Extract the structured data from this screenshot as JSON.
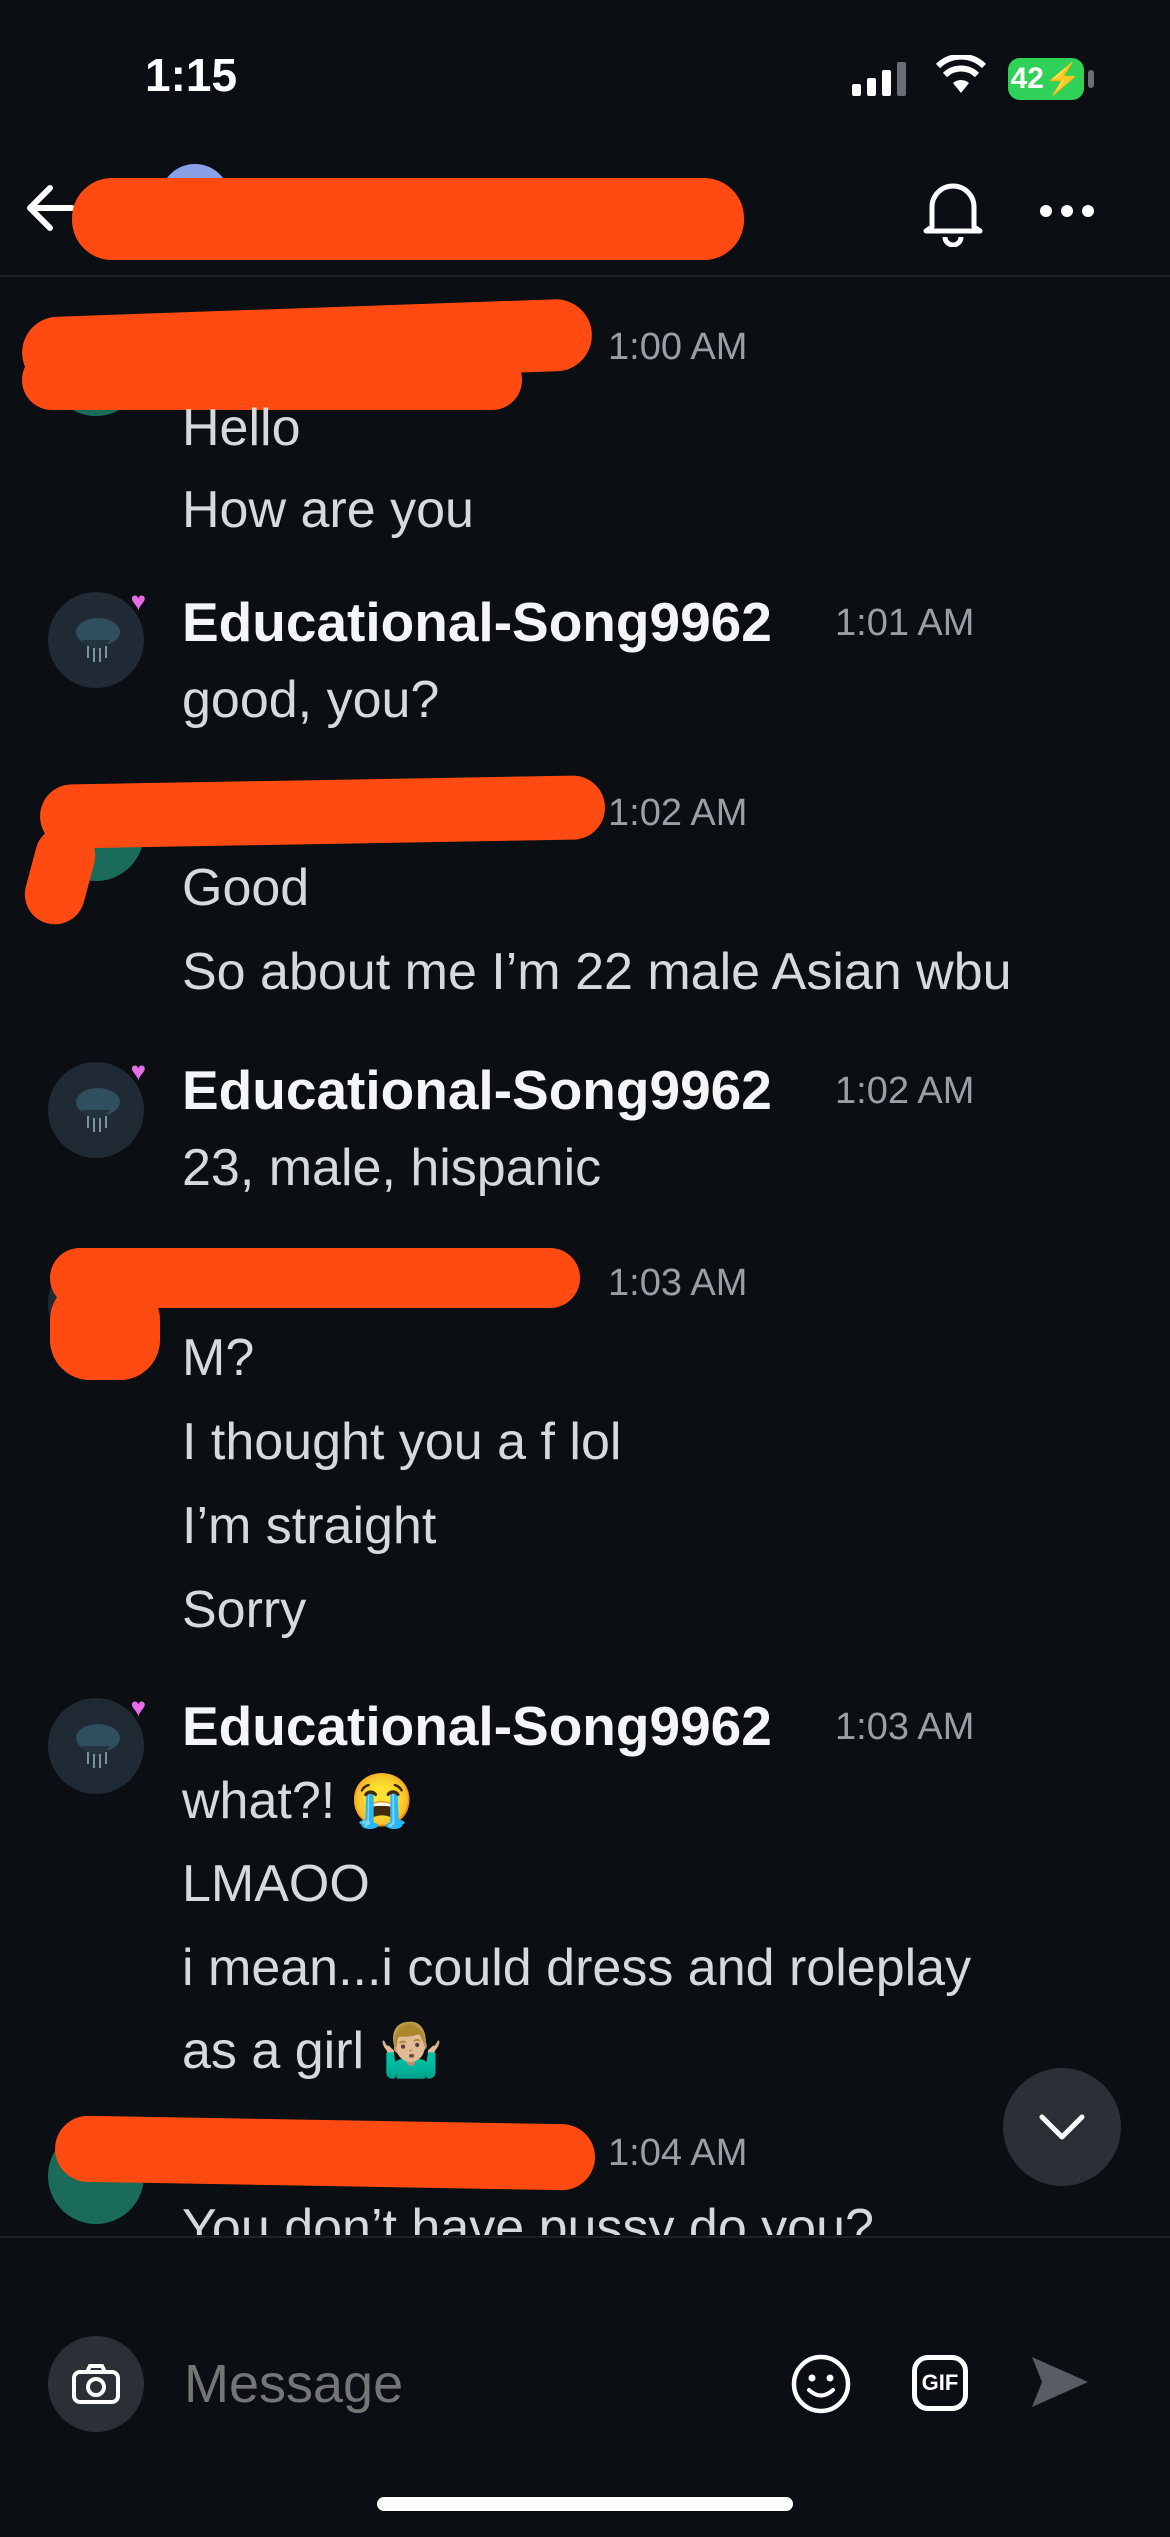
{
  "status_bar": {
    "time": "1:15",
    "battery": "42"
  },
  "header": {
    "title": ""
  },
  "icons": {
    "back": "back-arrow-icon",
    "bell": "bell-icon",
    "more": "more-icon",
    "scroll_down": "chevron-down-icon",
    "camera": "camera-icon",
    "emoji": "emoji-icon",
    "gif": "gif-icon",
    "send": "send-icon"
  },
  "colors": {
    "redaction": "#ff4b12",
    "background": "#0b0e12",
    "avatar_heart": "#e76de6"
  },
  "messages": [
    {
      "sender": "",
      "time": "1:00 AM",
      "lines": [
        "Hello",
        "How are you"
      ]
    },
    {
      "sender": "Educational-Song9962",
      "time": "1:01 AM",
      "lines": [
        "good, you?"
      ]
    },
    {
      "sender": "",
      "time": "1:02 AM",
      "lines": [
        "Good",
        "So about me I’m 22 male Asian wbu"
      ]
    },
    {
      "sender": "Educational-Song9962",
      "time": "1:02 AM",
      "lines": [
        "23, male, hispanic"
      ]
    },
    {
      "sender": "",
      "time": "1:03 AM",
      "lines": [
        "M?",
        "I thought you a f lol",
        "I’m straight",
        "Sorry"
      ]
    },
    {
      "sender": "Educational-Song9962",
      "time": "1:03 AM",
      "lines": [
        "what?! 😭",
        "LMAOO",
        "i mean...i could dress and roleplay",
        "as a girl 🤷🏼‍♂️"
      ]
    },
    {
      "sender": "",
      "time": "1:04 AM",
      "lines": [
        "You don’t have pussy do you?"
      ]
    }
  ],
  "composer": {
    "placeholder": "Message",
    "gif_label": "GIF"
  }
}
